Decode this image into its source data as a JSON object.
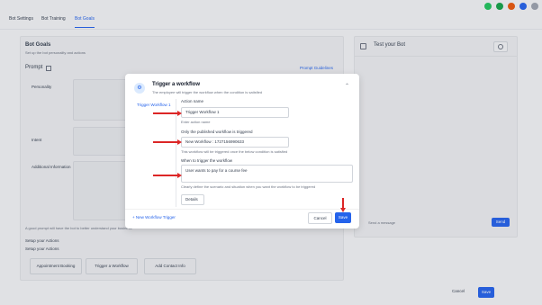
{
  "topbar": {
    "icons": [
      {
        "name": "phone-icon",
        "color": "#22c55e"
      },
      {
        "name": "message-icon",
        "color": "#16a34a"
      },
      {
        "name": "notification-icon",
        "color": "#ea580c"
      },
      {
        "name": "help-icon",
        "color": "#2563eb"
      },
      {
        "name": "user-avatar-icon",
        "color": "#6b7280"
      }
    ]
  },
  "tabs": [
    {
      "label": "Bot Settings"
    },
    {
      "label": "Bot Training"
    },
    {
      "label": "Bot Goals",
      "active": true
    }
  ],
  "left": {
    "title": "Bot Goals",
    "subtitle": "Set up the bot personality and actions",
    "prompt_label": "Prompt",
    "prompt_guidelines": "Prompt Guidelines",
    "fields": [
      "Personality",
      "Intent",
      "Additional Information"
    ],
    "prompt_note": "A good prompt will have the bot to better understand your business",
    "setup_actions_1": "Setup your Actions",
    "setup_actions_2": "Setup your Actions",
    "action_buttons": [
      "Appointment Booking",
      "Trigger a Workflow",
      "Add Contact Info"
    ]
  },
  "right": {
    "title": "Test your Bot",
    "message_placeholder": "Send a message",
    "send_label": "Send"
  },
  "footer": {
    "cancel_label": "Cancel",
    "save_label": "Save"
  },
  "modal": {
    "title": "Trigger a workflow",
    "subtitle": "The employee will trigger the workflow when the condition is satisfied",
    "side_tab": "Trigger Workflow 1",
    "action_name_label": "Action name",
    "action_name_value": "Trigger Workflow 1",
    "action_name_hint": "Enter action name",
    "workflow_label": "Only the published workflow is triggered",
    "workflow_value": "New Workflow : 1727156990633",
    "workflow_hint": "This workflow will be triggered once the below condition is satisfied",
    "when_label": "When to trigger the workflow",
    "when_value": "User wants to pay for a course fee",
    "when_hint": "Clearly define the scenario and situation when you want the workflow to be triggered",
    "chip_label": "Details",
    "add_trigger": "New Workflow Trigger",
    "cancel_label": "Cancel",
    "save_label": "Save"
  }
}
